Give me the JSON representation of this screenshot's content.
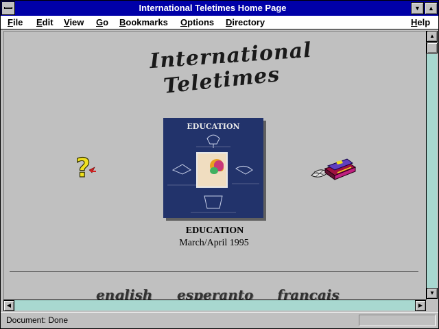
{
  "window": {
    "title": "International Teletimes Home Page"
  },
  "menubar": {
    "items": [
      "File",
      "Edit",
      "View",
      "Go",
      "Bookmarks",
      "Options",
      "Directory",
      "Help"
    ]
  },
  "page": {
    "logo_line1": "International",
    "logo_line2": "Teletimes",
    "cover": {
      "title": "EDUCATION"
    },
    "caption_title": "EDUCATION",
    "caption_date": "March/April 1995",
    "languages": [
      "english",
      "esperanto",
      "francais"
    ]
  },
  "status": {
    "text": "Document: Done"
  },
  "icons": {
    "system_menu": "system-menu-icon",
    "minimize": "triangle-down",
    "maximize": "triangle-up",
    "help": "question-mark",
    "books": "books-stack"
  },
  "colors": {
    "titlebar": "#0000a8",
    "window_bg": "#c0c0c0",
    "scroll_track": "#a8d8d0",
    "cover_bg": "#22336b"
  }
}
